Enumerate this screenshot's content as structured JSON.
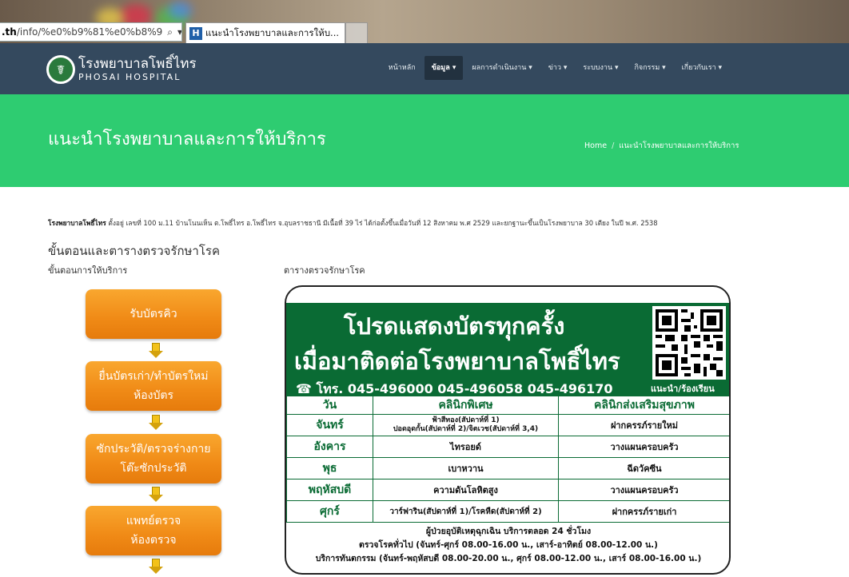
{
  "browser": {
    "address_host": ".th",
    "address_path": "/info/%e0%b9%81%e0%b8%9",
    "tab_title": "แนะนำโรงพยาบาลและการให้บ..."
  },
  "nav": {
    "logo_th": "โรงพยาบาลโพธิ์ไทร",
    "logo_en": "PHOSAI HOSPITAL",
    "items": [
      {
        "label": "หน้าหลัก",
        "active": false
      },
      {
        "label": "ข้อมูล ▾",
        "active": true
      },
      {
        "label": "ผลการดำเนินงาน ▾",
        "active": false
      },
      {
        "label": "ข่าว ▾",
        "active": false
      },
      {
        "label": "ระบบงาน ▾",
        "active": false
      },
      {
        "label": "กิจกรรม ▾",
        "active": false
      },
      {
        "label": "เกี่ยวกับเรา ▾",
        "active": false
      }
    ]
  },
  "hero": {
    "title": "แนะนำโรงพยาบาลและการให้บริการ",
    "breadcrumb_home": "Home",
    "breadcrumb_current": "แนะนำโรงพยาบาลและการให้บริการ"
  },
  "content": {
    "intro_bold": "โรงพยาบาลโพธิ์ไทร",
    "intro_text": " ตั้งอยู่ เลขที่ 100 ม.11 บ้านโนนเห็น ต.โพธิ์ไทร อ.โพธิ์ไทร จ.อุบลราชธานี มีเนื้อที่ 39 ไร่ ได้ก่อตั้งขึ้นเมื่อวันที่ 12 สิงหาคม พ.ศ 2529 และยกฐานะขึ้นเป็นโรงพยาบาล 30 เตียง ในปี พ.ศ. 2538",
    "heading": "ขั้นตอนและตารางตรวจรักษาโรค",
    "left_sub": "ขั้นตอนการให้บริการ",
    "right_sub": "ตารางตรวจรักษาโรค"
  },
  "flow": [
    {
      "line1": "รับบัตรคิว",
      "line2": ""
    },
    {
      "line1": "ยื่นบัตรเก่า/ทำบัตรใหม่",
      "line2": "ห้องบัตร"
    },
    {
      "line1": "ซักประวัติ/ตรวจร่างกาย",
      "line2": "โต๊ะซักประวัติ"
    },
    {
      "line1": "แพทย์ตรวจ",
      "line2": "ห้องตรวจ"
    }
  ],
  "schedule": {
    "banner_line1": "โปรดแสดงบัตรทุกครั้ง",
    "banner_line2": "เมื่อมาติดต่อโรงพยาบาลโพธิ์ไทร",
    "phone": "☎ โทร. 045-496000 045-496058 045-496170",
    "qr_caption": "แนะนำ/ร้องเรียน",
    "headers": [
      "วัน",
      "คลินิกพิเศษ",
      "คลินิกส่งเสริมสุขภาพ"
    ],
    "rows": [
      {
        "day": "จันทร์",
        "special": "ฟ้าสีทอง(สัปดาห์ที่ 1)\nปอดอุดกั้น(สัปดาห์ที่ 2)/จิตเวช(สัปดาห์ที่ 3,4)",
        "promo": "ฝากครรภ์รายใหม่"
      },
      {
        "day": "อังคาร",
        "special": "ไทรอยด์",
        "promo": "วางแผนครอบครัว"
      },
      {
        "day": "พุธ",
        "special": "เบาหวาน",
        "promo": "ฉีดวัคซีน"
      },
      {
        "day": "พฤหัสบดี",
        "special": "ความดันโลหิตสูง",
        "promo": "วางแผนครอบครัว"
      },
      {
        "day": "ศุกร์",
        "special": "วาร์ฟาริน(สัปดาห์ที่ 1)/โรคหืด(สัปดาห์ที่ 2)",
        "promo": "ฝากครรภ์รายเก่า"
      }
    ],
    "footer": [
      "ผู้ป่วยอุบัติเหตุฉุกเฉิน บริการตลอด 24 ชั่วโมง",
      "ตรวจโรคทั่วไป (จันทร์-ศุกร์ 08.00-16.00 น., เสาร์-อาทิตย์ 08.00-12.00 น.)",
      "บริการทันตกรรม (จันทร์-พฤหัสบดี 08.00-20.00 น., ศุกร์ 08.00-12.00 น., เสาร์ 08.00-16.00 น.)"
    ]
  },
  "colors": {
    "nav_bg": "#34495e",
    "hero_bg": "#2ecc71",
    "flow_orange": "#f08a16",
    "banner_green": "#0a6b34"
  }
}
